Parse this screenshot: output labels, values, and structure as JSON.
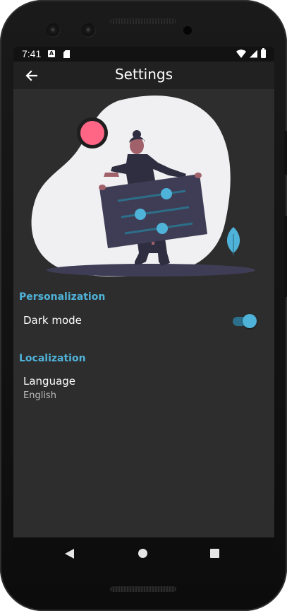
{
  "status_bar": {
    "time": "7:41",
    "icons": [
      "a-notification-icon",
      "sd-card-icon",
      "wifi-icon",
      "signal-icon",
      "battery-icon"
    ],
    "notification_glyph": "A"
  },
  "app_bar": {
    "title": "Settings",
    "back_icon": "arrow-back-icon"
  },
  "sections": {
    "personalization": {
      "header": "Personalization",
      "dark_mode": {
        "title": "Dark mode",
        "enabled": true
      }
    },
    "localization": {
      "header": "Localization",
      "language": {
        "title": "Language",
        "value": "English"
      }
    }
  },
  "navigation_bar": {
    "buttons": [
      "back-triangle-icon",
      "home-circle-icon",
      "recents-square-icon"
    ]
  },
  "colors": {
    "accent": "#4fb3d9",
    "background": "#2d2d2d",
    "app_bar": "#212121",
    "illustration_pink": "#ff6584",
    "illustration_blob": "#f0f0f2",
    "illustration_panel": "#3f3d56"
  }
}
